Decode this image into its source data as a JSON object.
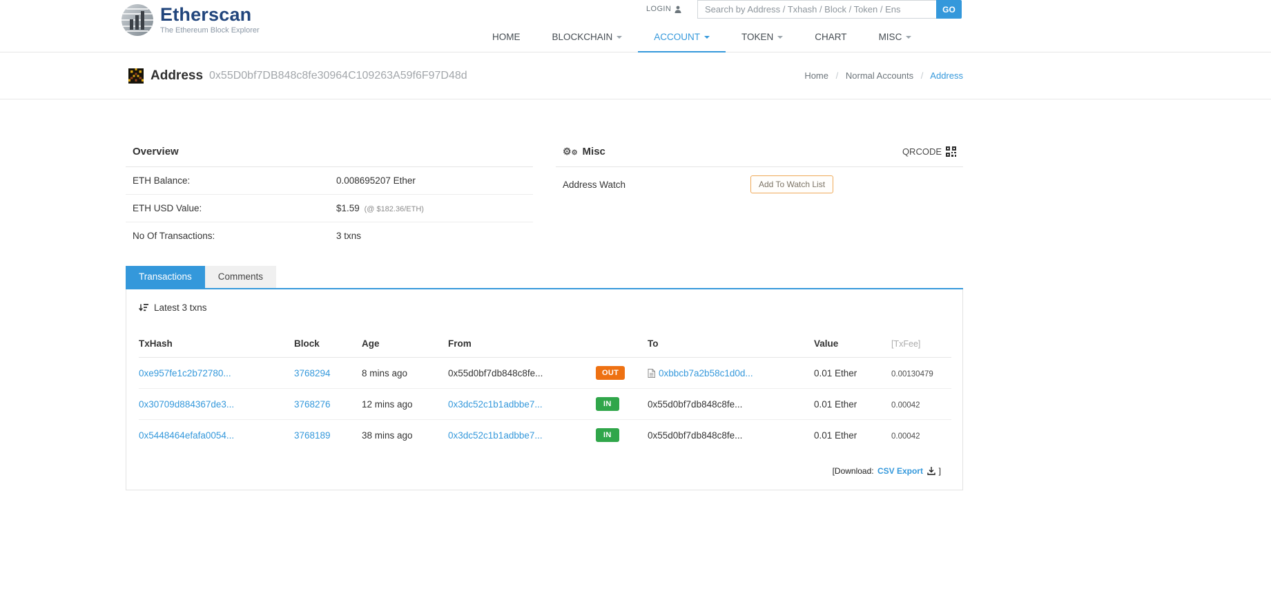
{
  "colors": {
    "accent": "#3498db",
    "link": "#3498db",
    "badge_in": "#30a64a",
    "badge_out": "#ee7112",
    "logo_text": "#21457c"
  },
  "header": {
    "logo_title": "Etherscan",
    "logo_tagline": "The Ethereum Block Explorer",
    "login_label": "LOGIN",
    "search_placeholder": "Search by Address / Txhash / Block / Token / Ens",
    "go_label": "GO",
    "nav": {
      "home": "HOME",
      "blockchain": "BLOCKCHAIN",
      "account": "ACCOUNT",
      "token": "TOKEN",
      "chart": "CHART",
      "misc": "MISC"
    }
  },
  "page": {
    "title": "Address",
    "address": "0x55D0bf7DB848c8fe30964C109263A59f6F97D48d",
    "breadcrumb": {
      "home": "Home",
      "section": "Normal Accounts",
      "current": "Address"
    }
  },
  "overview": {
    "title": "Overview",
    "rows": [
      {
        "label": "ETH Balance:",
        "value": "0.008695207 Ether",
        "sub": ""
      },
      {
        "label": "ETH USD Value:",
        "value": "$1.59",
        "sub": "(@ $182.36/ETH)"
      },
      {
        "label": "No Of Transactions:",
        "value": "3 txns",
        "sub": ""
      }
    ]
  },
  "misc_panel": {
    "title": "Misc",
    "qrcode_label": "QRCODE",
    "address_watch_label": "Address Watch",
    "watch_button_label": "Add To Watch List"
  },
  "tabs": {
    "transactions": "Transactions",
    "comments": "Comments"
  },
  "transactions": {
    "latest_label": "Latest 3 txns",
    "columns": {
      "txhash": "TxHash",
      "block": "Block",
      "age": "Age",
      "from": "From",
      "to": "To",
      "value": "Value",
      "txfee": "[TxFee]"
    },
    "rows": [
      {
        "txhash": "0xe957fe1c2b72780...",
        "block": "3768294",
        "age": "8 mins ago",
        "from": "0x55d0bf7db848c8fe...",
        "direction": "OUT",
        "to": "0xbbcb7a2b58c1d0d...",
        "value": "0.01 Ether",
        "txfee": "0.00130479"
      },
      {
        "txhash": "0x30709d884367de3...",
        "block": "3768276",
        "age": "12 mins ago",
        "from": "0x3dc52c1b1adbbe7...",
        "direction": "IN",
        "to": "0x55d0bf7db848c8fe...",
        "value": "0.01 Ether",
        "txfee": "0.00042"
      },
      {
        "txhash": "0x5448464efafa0054...",
        "block": "3768189",
        "age": "38 mins ago",
        "from": "0x3dc52c1b1adbbe7...",
        "direction": "IN",
        "to": "0x55d0bf7db848c8fe...",
        "value": "0.01 Ether",
        "txfee": "0.00042"
      }
    ],
    "download": {
      "prefix": "[Download:",
      "link": "CSV Export",
      "suffix": "]"
    }
  }
}
